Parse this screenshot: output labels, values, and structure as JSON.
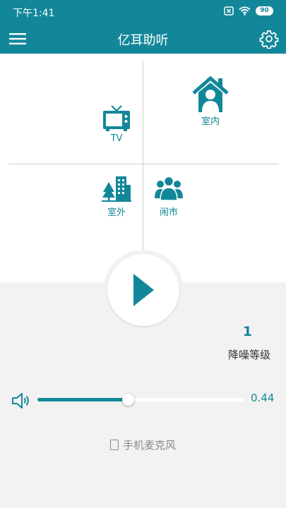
{
  "status_bar": {
    "time": "下午1:41",
    "battery": "90"
  },
  "app_bar": {
    "title": "亿耳助听"
  },
  "scenes": [
    {
      "id": "tv",
      "label": "TV",
      "icon": "tv-icon"
    },
    {
      "id": "indoor",
      "label": "室内",
      "icon": "house-person-icon"
    },
    {
      "id": "outdoor",
      "label": "室外",
      "icon": "city-tree-icon"
    },
    {
      "id": "crowd",
      "label": "闹市",
      "icon": "crowd-icon"
    }
  ],
  "play": {
    "icon": "play-icon"
  },
  "noise_reduction": {
    "level": "1",
    "label": "降噪等级"
  },
  "volume": {
    "value_text": "0.44",
    "level": 0.44,
    "icon": "speaker-icon"
  },
  "mic": {
    "label": "手机麦克风",
    "checked": false
  },
  "colors": {
    "accent": "#13879a",
    "background": "#f2f2f2",
    "panel": "#ffffff"
  }
}
